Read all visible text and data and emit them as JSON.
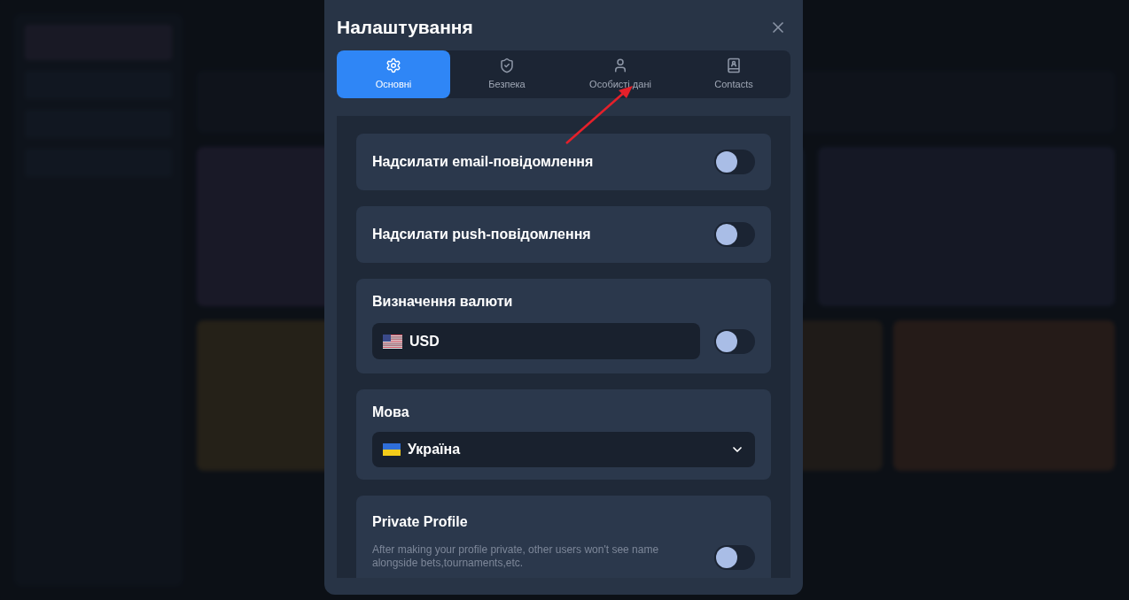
{
  "dialog": {
    "title": "Налаштування"
  },
  "tabs": [
    {
      "label": "Основні",
      "selected": true
    },
    {
      "label": "Безпека",
      "selected": false
    },
    {
      "label": "Особисті дані",
      "selected": false
    },
    {
      "label": "Contacts",
      "selected": false
    }
  ],
  "settings": [
    {
      "kind": "toggle",
      "label": "Надсилати email-повідомлення",
      "on": false
    },
    {
      "kind": "toggle",
      "label": "Надсилати push-повідомлення",
      "on": false
    },
    {
      "kind": "currency",
      "label": "Визначення валюти",
      "value": "USD",
      "on": false
    },
    {
      "kind": "select",
      "label": "Мова",
      "value": "Україна"
    },
    {
      "kind": "toggle",
      "label": "Private Profile",
      "description": "After making your profile private, other users won't see name alongside bets,tournaments,etc.",
      "on": false
    }
  ]
}
